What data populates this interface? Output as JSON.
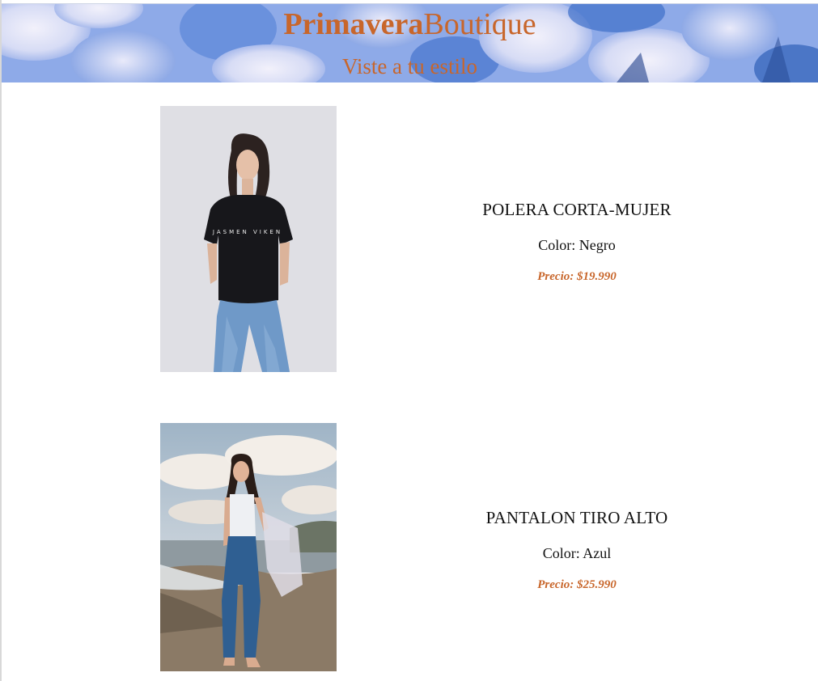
{
  "header": {
    "brand_part1": "Primavera",
    "brand_part2": "Boutique",
    "tagline": "Viste a tu estilo"
  },
  "products": [
    {
      "name": "POLERA CORTA-MUJER",
      "color": "Color: Negro",
      "price": "Precio: $19.990",
      "photo_text": "JASMEN VIKEN"
    },
    {
      "name": "PANTALON TIRO ALTO",
      "color": "Color: Azul",
      "price": "Precio: $25.990"
    }
  ],
  "colors": {
    "accent": "#c8662b",
    "text": "#111111",
    "background": "#ffffff"
  }
}
